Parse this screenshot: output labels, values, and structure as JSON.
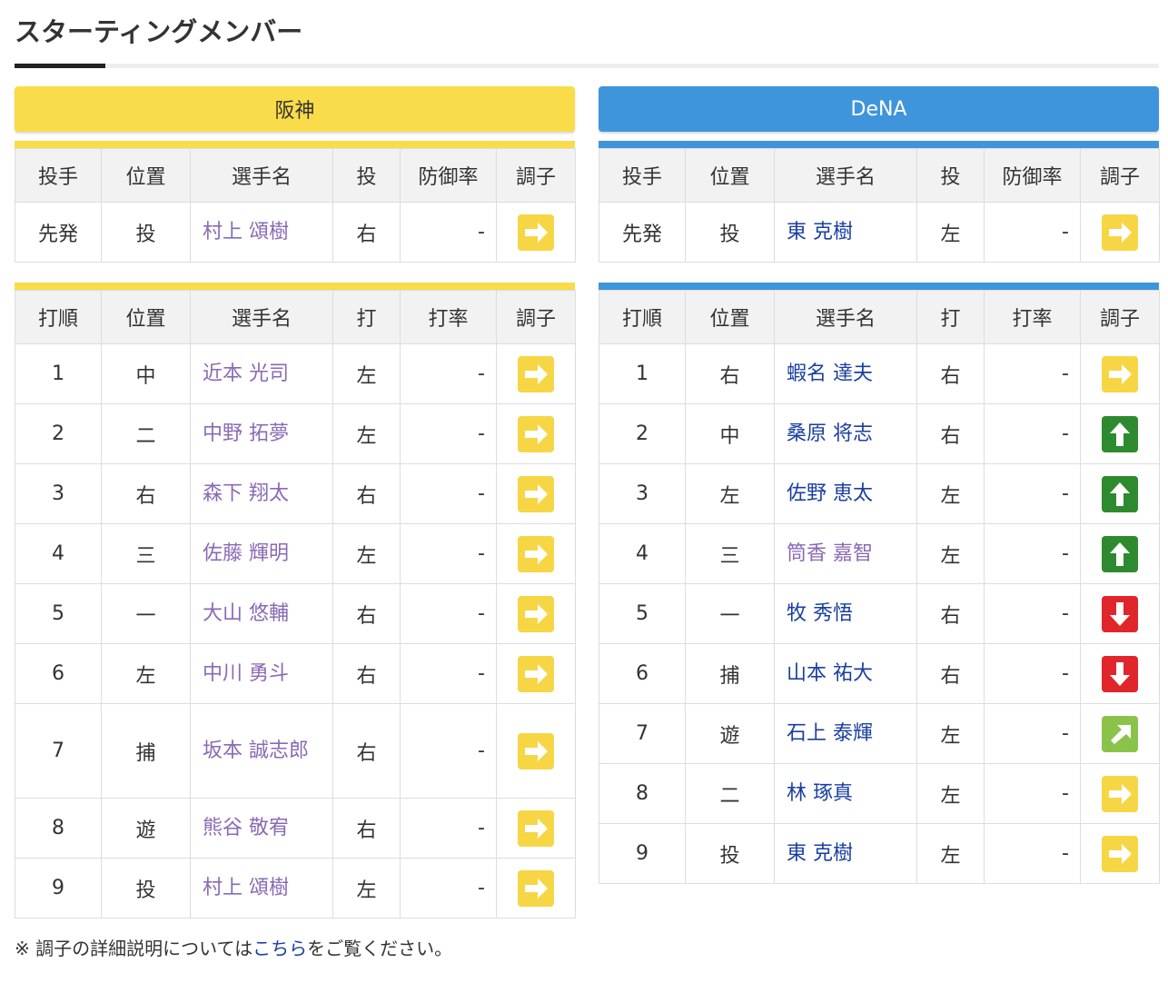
{
  "page_title": "スターティングメンバー",
  "teams": {
    "hanshin": {
      "name": "阪神",
      "pitcher_headers": [
        "投手",
        "位置",
        "選手名",
        "投",
        "防御率",
        "調子"
      ],
      "pitcher": {
        "role": "先発",
        "pos": "投",
        "name": "村上 頌樹",
        "hand": "右",
        "era": "-",
        "condition": "right-arrow"
      },
      "batter_headers": [
        "打順",
        "位置",
        "選手名",
        "打",
        "打率",
        "調子"
      ],
      "batters": [
        {
          "order": "1",
          "pos": "中",
          "name": "近本 光司",
          "hand": "左",
          "avg": "-",
          "condition": "right-arrow"
        },
        {
          "order": "2",
          "pos": "二",
          "name": "中野 拓夢",
          "hand": "左",
          "avg": "-",
          "condition": "right-arrow"
        },
        {
          "order": "3",
          "pos": "右",
          "name": "森下 翔太",
          "hand": "右",
          "avg": "-",
          "condition": "right-arrow"
        },
        {
          "order": "4",
          "pos": "三",
          "name": "佐藤 輝明",
          "hand": "左",
          "avg": "-",
          "condition": "right-arrow"
        },
        {
          "order": "5",
          "pos": "一",
          "name": "大山 悠輔",
          "hand": "右",
          "avg": "-",
          "condition": "right-arrow"
        },
        {
          "order": "6",
          "pos": "左",
          "name": "中川 勇斗",
          "hand": "右",
          "avg": "-",
          "condition": "right-arrow"
        },
        {
          "order": "7",
          "pos": "捕",
          "name": "坂本 誠志郎",
          "hand": "右",
          "avg": "-",
          "condition": "right-arrow"
        },
        {
          "order": "8",
          "pos": "遊",
          "name": "熊谷 敬宥",
          "hand": "右",
          "avg": "-",
          "condition": "right-arrow"
        },
        {
          "order": "9",
          "pos": "投",
          "name": "村上 頌樹",
          "hand": "左",
          "avg": "-",
          "condition": "right-arrow"
        }
      ]
    },
    "dena": {
      "name": "DeNA",
      "pitcher_headers": [
        "投手",
        "位置",
        "選手名",
        "投",
        "防御率",
        "調子"
      ],
      "pitcher": {
        "role": "先発",
        "pos": "投",
        "name": "東 克樹",
        "hand": "左",
        "era": "-",
        "condition": "right-arrow"
      },
      "batter_headers": [
        "打順",
        "位置",
        "選手名",
        "打",
        "打率",
        "調子"
      ],
      "batters": [
        {
          "order": "1",
          "pos": "右",
          "name": "蝦名 達夫",
          "hand": "右",
          "avg": "-",
          "condition": "right-arrow"
        },
        {
          "order": "2",
          "pos": "中",
          "name": "桑原 将志",
          "hand": "右",
          "avg": "-",
          "condition": "up-arrow"
        },
        {
          "order": "3",
          "pos": "左",
          "name": "佐野 恵太",
          "hand": "左",
          "avg": "-",
          "condition": "up-arrow"
        },
        {
          "order": "4",
          "pos": "三",
          "name": "筒香 嘉智",
          "hand": "左",
          "avg": "-",
          "condition": "up-arrow"
        },
        {
          "order": "5",
          "pos": "一",
          "name": "牧 秀悟",
          "hand": "右",
          "avg": "-",
          "condition": "down-arrow"
        },
        {
          "order": "6",
          "pos": "捕",
          "name": "山本 祐大",
          "hand": "右",
          "avg": "-",
          "condition": "down-arrow"
        },
        {
          "order": "7",
          "pos": "遊",
          "name": "石上 泰輝",
          "hand": "左",
          "avg": "-",
          "condition": "up-right-arrow"
        },
        {
          "order": "8",
          "pos": "二",
          "name": "林 琢真",
          "hand": "左",
          "avg": "-",
          "condition": "right-arrow"
        },
        {
          "order": "9",
          "pos": "投",
          "name": "東 克樹",
          "hand": "左",
          "avg": "-",
          "condition": "right-arrow"
        }
      ]
    }
  },
  "footnote": {
    "prefix": "※ 調子の詳細説明については",
    "link": "こちら",
    "suffix": "をご覧ください。"
  },
  "colors": {
    "hanshin": "#f9dc4a",
    "dena": "#3f95db",
    "visited_name": "#8a6ab4",
    "link_name": "#1a3fa0",
    "cond_right": "#f6d645",
    "cond_up": "#2e8a2f",
    "cond_down": "#e0262b",
    "cond_upright": "#8bc34a"
  }
}
